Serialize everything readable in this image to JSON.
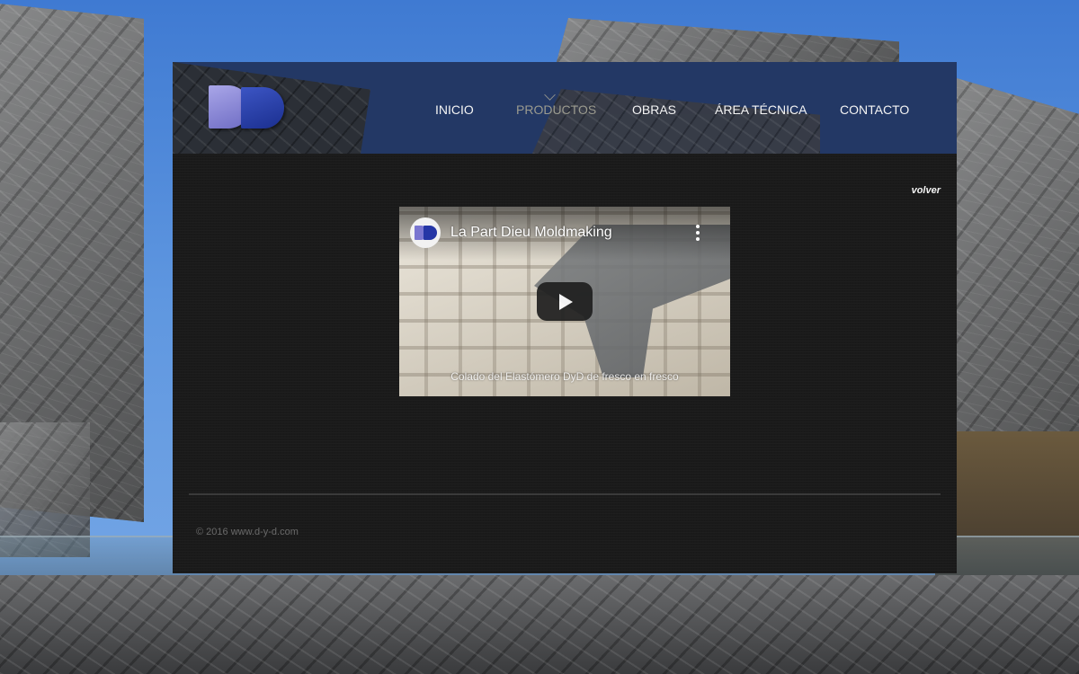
{
  "nav": {
    "items": [
      {
        "label": "INICIO"
      },
      {
        "label": "PRODUCTOS",
        "active": true
      },
      {
        "label": "OBRAS"
      },
      {
        "label": "ÁREA TÉCNICA"
      },
      {
        "label": "CONTACTO"
      }
    ]
  },
  "main": {
    "back_link": "volver",
    "video": {
      "title": "La Part Dieu Moldmaking",
      "caption": "Colado del Elastómero DyD de fresco en fresco"
    }
  },
  "footer": {
    "copyright": "© 2016 www.d-y-d.com"
  },
  "icons": {
    "logo": "dyd-logo",
    "play": "play-icon",
    "menu": "more-vert-icon",
    "caret": "chevron-down-icon"
  },
  "colors": {
    "header_bg": "#233865",
    "content_bg": "#1a1a1a",
    "nav_text": "#f4f4f4",
    "nav_active": "#9b9b8f",
    "footer_text": "#6a6a6a"
  }
}
